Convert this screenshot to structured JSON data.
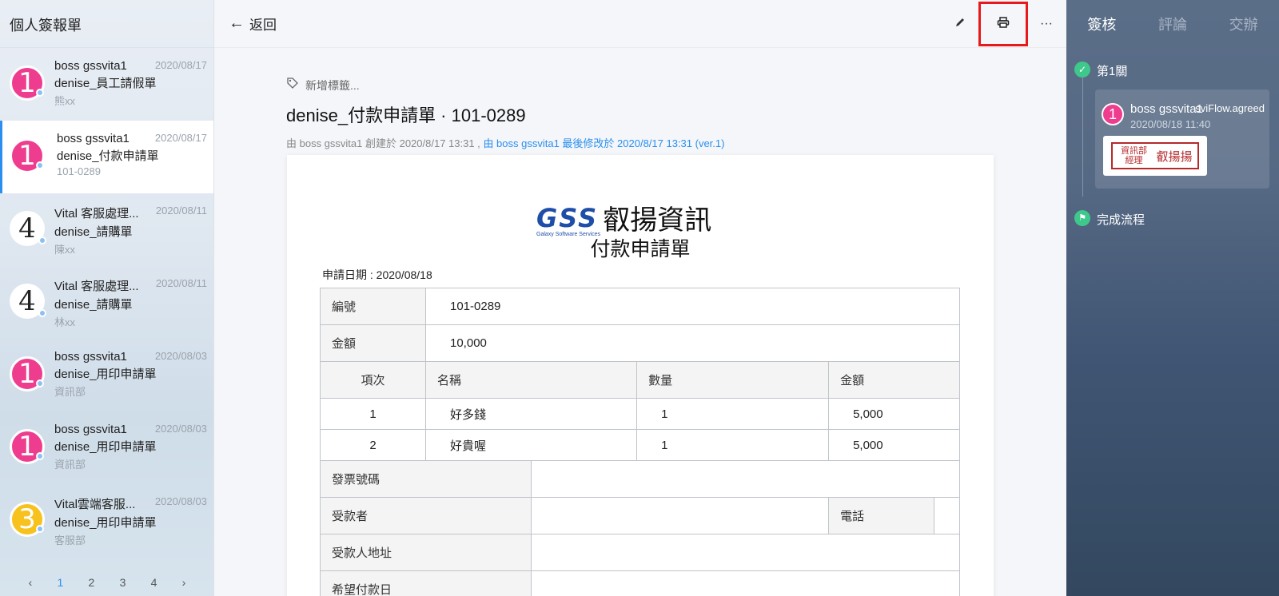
{
  "sidebar": {
    "title": "個人簽報單",
    "items": [
      {
        "avatar": "1",
        "color": "pink",
        "name": "boss gssvita1",
        "date": "2020/08/17",
        "title": "denise_員工請假單",
        "sub": "熊xx"
      },
      {
        "avatar": "1",
        "color": "pink",
        "name": "boss gssvita1",
        "date": "2020/08/17",
        "title": "denise_付款申請單",
        "sub": "101-0289"
      },
      {
        "avatar": "4",
        "color": "white",
        "name": "Vital 客服處理...",
        "date": "2020/08/11",
        "title": "denise_請購單",
        "sub": "陳xx"
      },
      {
        "avatar": "4",
        "color": "white",
        "name": "Vital 客服處理...",
        "date": "2020/08/11",
        "title": "denise_請購單",
        "sub": "林xx"
      },
      {
        "avatar": "1",
        "color": "pink",
        "name": "boss gssvita1",
        "date": "2020/08/03",
        "title": "denise_用印申請單",
        "sub": "資訊部"
      },
      {
        "avatar": "1",
        "color": "pink",
        "name": "boss gssvita1",
        "date": "2020/08/03",
        "title": "denise_用印申請單",
        "sub": "資訊部"
      },
      {
        "avatar": "3",
        "color": "yellow",
        "name": "Vital雲端客服...",
        "date": "2020/08/03",
        "title": "denise_用印申請單",
        "sub": "客服部"
      }
    ],
    "pager": {
      "prev": "‹",
      "pages": [
        "1",
        "2",
        "3",
        "4"
      ],
      "next": "›",
      "current": "1"
    }
  },
  "topbar": {
    "back_label": "返回",
    "edit_icon": "pencil-icon",
    "print_icon": "printer-icon",
    "more_label": "···"
  },
  "document": {
    "tag_placeholder": "新增標籤...",
    "title": "denise_付款申請單 · 101-0289",
    "meta_created": "由 boss gssvita1 創建於 2020/8/17 13:31 ,",
    "meta_modified": "由 boss gssvita1 最後修改於 2020/8/17 13:31 (ver.1)"
  },
  "form": {
    "logo_text": "GSS",
    "logo_sub": "Galaxy Software Services",
    "logo_cn": "叡揚資訊",
    "title": "付款申請單",
    "apply_date": "申請日期 : 2020/08/18",
    "number_label": "編號",
    "number_value": "101-0289",
    "amount_label": "金額",
    "amount_value": "10,000",
    "columns": [
      "項次",
      "名稱",
      "數量",
      "金額"
    ],
    "rows": [
      {
        "no": "1",
        "name": "好多錢",
        "qty": "1",
        "amount": "5,000"
      },
      {
        "no": "2",
        "name": "好貴喔",
        "qty": "1",
        "amount": "5,000"
      }
    ],
    "invoice_label": "發票號碼",
    "payee_label": "受款者",
    "phone_label": "電話",
    "address_label": "受款人地址",
    "pay_date_label": "希望付款日"
  },
  "right_panel": {
    "tabs": [
      "簽核",
      "評論",
      "交辦"
    ],
    "step1_label": "第1關",
    "signer_avatar": "1",
    "signer_name": "boss gssvita1",
    "signer_status": "sviFlow.agreed",
    "signer_time": "2020/08/18 11:40",
    "stamp_dept": "資訊部 經理",
    "stamp_name": "叡揚揚",
    "step2_label": "完成流程"
  },
  "colors": {
    "accent": "#2a8ff0",
    "pink": "#ee3d8f",
    "yellow": "#f7c21e",
    "success": "#3fc88c",
    "highlight": "#e8191b"
  }
}
